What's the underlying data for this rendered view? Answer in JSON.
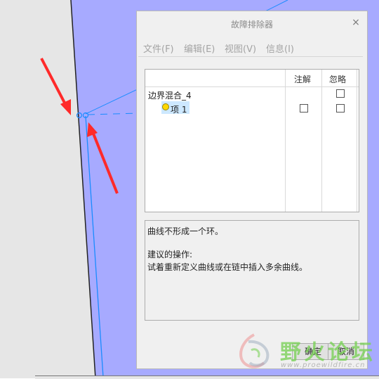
{
  "dialog": {
    "title": "故障排除器",
    "close_glyph": "×"
  },
  "menu": [
    "文件(F)",
    "编辑(E)",
    "视图(V)",
    "信息(I)"
  ],
  "tree": {
    "headers": {
      "note": "注解",
      "ignore": "忽略"
    },
    "root_label": "边界混合_4",
    "item_label": "项 1"
  },
  "message": {
    "line1": "曲线不形成一个环。",
    "line2": "建议的操作:",
    "line3": "试着重新定义曲线或在链中插入多余曲线。"
  },
  "buttons": {
    "ok": "确定",
    "cancel": "取消"
  },
  "watermark": {
    "text": "野火论坛",
    "url": "www.proewildfire.cn"
  },
  "colors": {
    "viewport": "#a7aaff",
    "curve": "#1a8cff",
    "arrow": "#ff2a2a",
    "selection": "#cde8ff"
  }
}
